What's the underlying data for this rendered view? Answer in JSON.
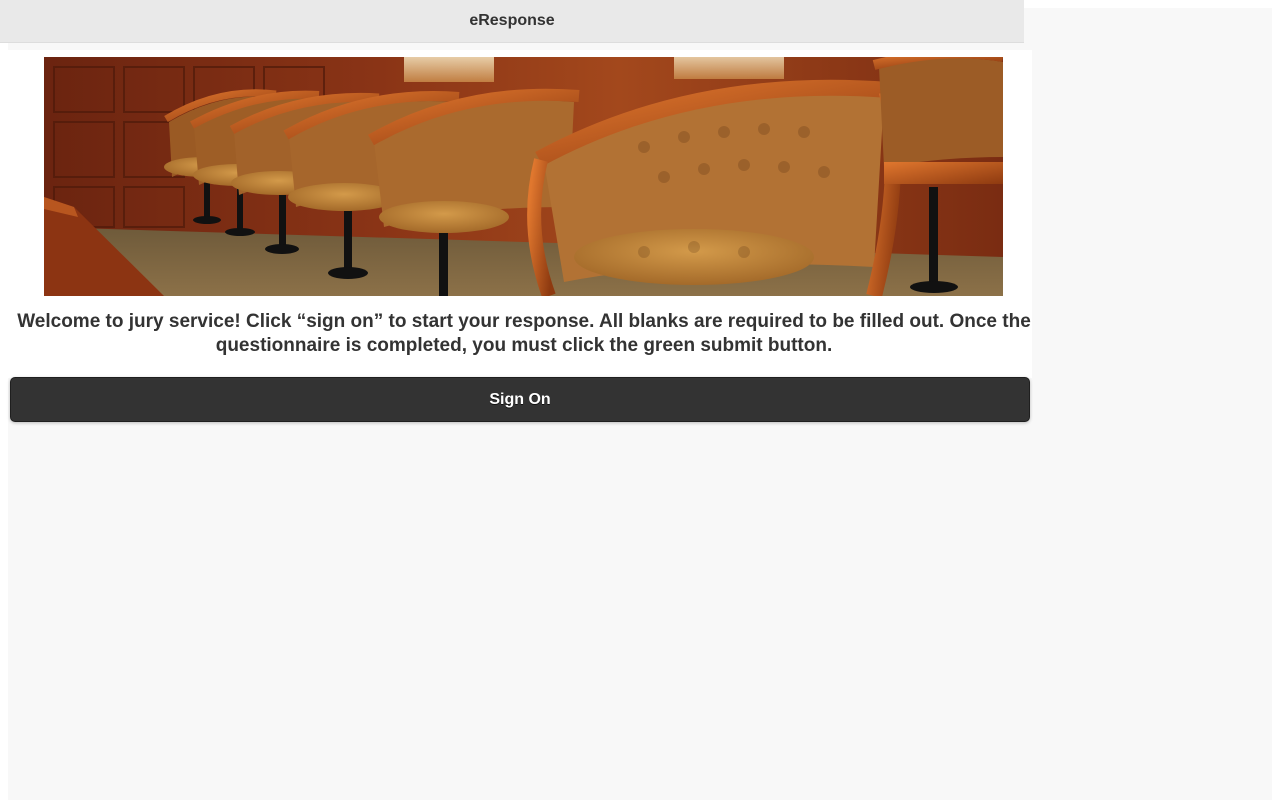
{
  "header": {
    "title": "eResponse"
  },
  "banner": {
    "alt": "jury box chairs"
  },
  "main": {
    "welcome_text": "Welcome to jury service! Click “sign on” to start your response. All blanks are required to be filled out. Once the questionnaire is completed, you must click the green submit button."
  },
  "actions": {
    "sign_on_label": "Sign On"
  },
  "colors": {
    "header_bg": "#e9e9e9",
    "button_bg": "#333333",
    "button_text": "#ffffff",
    "page_bg": "#f8f8f8"
  }
}
